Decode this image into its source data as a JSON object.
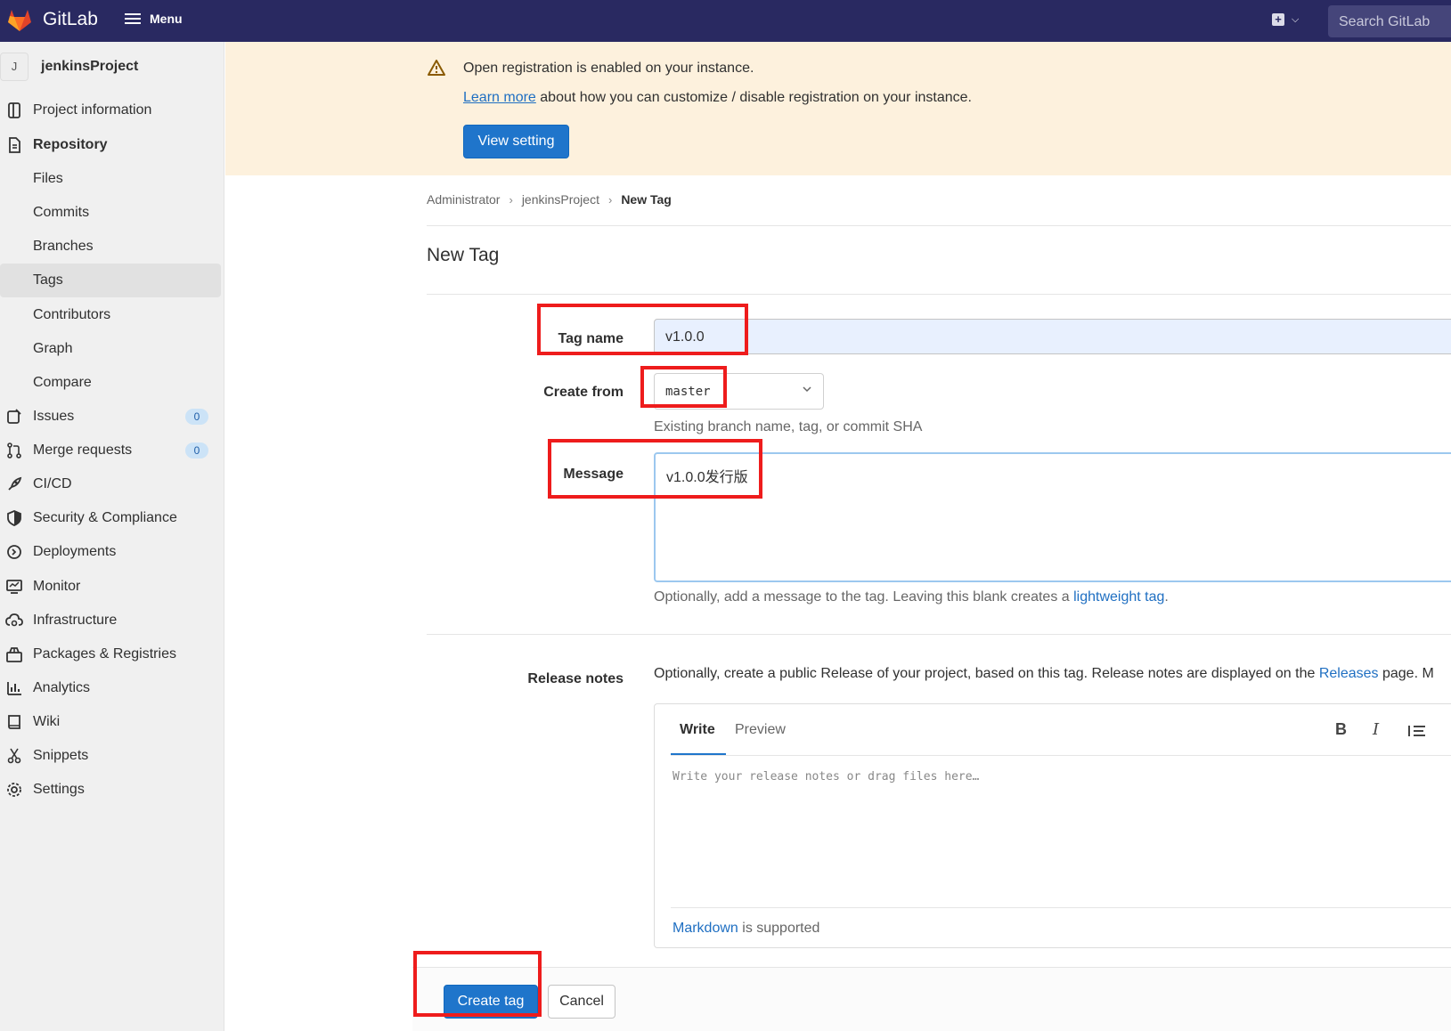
{
  "topbar": {
    "brand": "GitLab",
    "menu_label": "Menu",
    "search_placeholder": "Search GitLab"
  },
  "sidebar": {
    "project_avatar": "J",
    "project_name": "jenkinsProject",
    "items": [
      {
        "label": "Project information",
        "icon": "project-info-icon"
      },
      {
        "label": "Repository",
        "icon": "repository-icon"
      },
      {
        "label": "Files"
      },
      {
        "label": "Commits"
      },
      {
        "label": "Branches"
      },
      {
        "label": "Tags"
      },
      {
        "label": "Contributors"
      },
      {
        "label": "Graph"
      },
      {
        "label": "Compare"
      },
      {
        "label": "Issues",
        "icon": "issues-icon",
        "badge": "0"
      },
      {
        "label": "Merge requests",
        "icon": "merge-request-icon",
        "badge": "0"
      },
      {
        "label": "CI/CD",
        "icon": "rocket-icon"
      },
      {
        "label": "Security & Compliance",
        "icon": "shield-icon"
      },
      {
        "label": "Deployments",
        "icon": "deployments-icon"
      },
      {
        "label": "Monitor",
        "icon": "monitor-icon"
      },
      {
        "label": "Infrastructure",
        "icon": "cloud-gear-icon"
      },
      {
        "label": "Packages & Registries",
        "icon": "package-icon"
      },
      {
        "label": "Analytics",
        "icon": "chart-icon"
      },
      {
        "label": "Wiki",
        "icon": "book-icon"
      },
      {
        "label": "Snippets",
        "icon": "scissors-icon"
      },
      {
        "label": "Settings",
        "icon": "gear-icon"
      }
    ]
  },
  "banner": {
    "title": "Open registration is enabled on your instance.",
    "learn_more": "Learn more",
    "text": " about how you can customize / disable registration on your instance.",
    "button": "View setting"
  },
  "breadcrumb": {
    "items": [
      "Administrator",
      "jenkinsProject",
      "New Tag"
    ]
  },
  "page": {
    "title": "New Tag"
  },
  "form": {
    "tag_name_label": "Tag name",
    "tag_name_value": "v1.0.0",
    "create_from_label": "Create from",
    "create_from_value": "master",
    "create_from_help": "Existing branch name, tag, or commit SHA",
    "message_label": "Message",
    "message_value": "v1.0.0发行版",
    "message_help": "Optionally, add a message to the tag. Leaving this blank creates a ",
    "message_help_link": "lightweight tag",
    "message_help_end": ".",
    "release_notes_label": "Release notes",
    "release_notes_help": "Optionally, create a public Release of your project, based on this tag. Release notes are displayed on the ",
    "release_notes_link": "Releases",
    "release_notes_help_end": " page. M",
    "editor_write": "Write",
    "editor_preview": "Preview",
    "editor_placeholder": "Write your release notes or drag files here…",
    "markdown_link": "Markdown",
    "markdown_text": " is supported",
    "create_button": "Create tag",
    "cancel_button": "Cancel"
  },
  "colors": {
    "topbar": "#292961",
    "accent": "#1f75cb",
    "banner": "#fdf1dd",
    "highlight": "#ee1c1c"
  }
}
